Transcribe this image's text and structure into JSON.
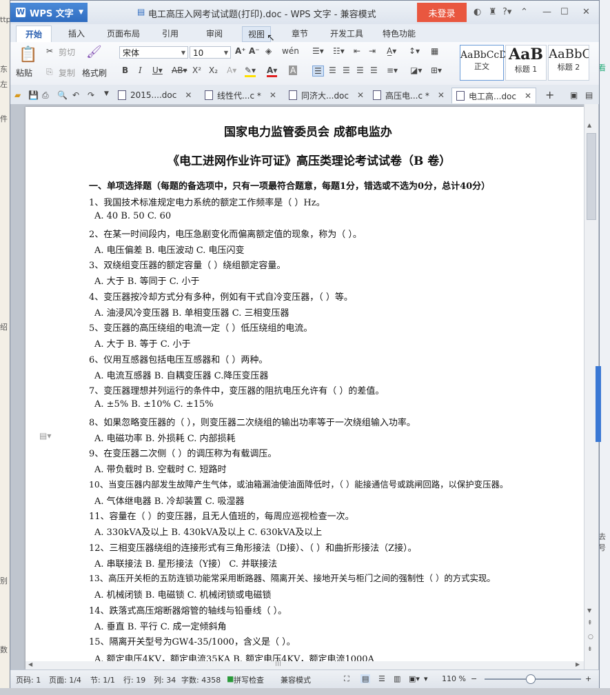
{
  "background": {
    "left_texts": [
      "ttp",
      "东",
      "左",
      "件",
      "绍",
      "别",
      "数"
    ],
    "right_texts": [
      "看",
      "去号"
    ]
  },
  "window": {
    "app_name": "WPS 文字",
    "title": "电工高压入网考试试题(打印).doc - WPS 文字 - 兼容模式",
    "login_label": "未登录"
  },
  "menu": {
    "tabs": [
      "开始",
      "插入",
      "页面布局",
      "引用",
      "审阅",
      "视图",
      "章节",
      "开发工具",
      "特色功能"
    ]
  },
  "ribbon": {
    "paste_label": "粘贴",
    "cut_label": "剪切",
    "copy_label": "复制",
    "format_painter_label": "格式刷",
    "font_name": "宋体",
    "font_size": "10",
    "styles": [
      {
        "preview": "AaBbCcD",
        "label": "正文"
      },
      {
        "preview": "AaB",
        "label": "标题 1"
      },
      {
        "preview": "AaBbC",
        "label": "标题 2"
      }
    ]
  },
  "doc_tabs": [
    {
      "label": "2015....doc",
      "modified": false
    },
    {
      "label": "线性代...c *",
      "modified": true
    },
    {
      "label": "同济大...doc",
      "modified": false
    },
    {
      "label": "高压电...c *",
      "modified": true
    },
    {
      "label": "电工高...doc",
      "modified": false,
      "active": true
    }
  ],
  "document": {
    "org_line": "国家电力监管委员会    成都电监办",
    "title": "《电工进网作业许可证》高压类理论考试试卷（B 卷）",
    "section": "一、单项选择题（每题的备选项中，只有一项最符合题意，每题1分，错选或不选为0分，总计40分）",
    "lines": [
      "1、我国技术标准规定电力系统的额定工作频率是（  ）Hz。",
      "  A. 40    B. 50   C. 60",
      "2、在某一时间段内，电压急剧变化而偏离额定值的现象，称为（  ）。",
      "  A. 电压偏差    B. 电压波动    C. 电压闪变",
      "3、双绕组变压器的额定容量（ ）绕组额定容量。",
      "  A. 大于       B. 等同于       C. 小于",
      "4、变压器按冷却方式分有多种，例如有干式自冷变压器，（  ）等。",
      "  A. 油浸风冷变压器         B. 单相变压器    C. 三相变压器",
      "5、变压器的高压绕组的电流一定（  ）低压绕组的电流。",
      "  A. 大于      B. 等于      C. 小于",
      "6、仪用互感器包括电压互感器和（  ）两种。",
      "  A. 电流互感器      B. 自耦变压器        C.降压变压器",
      "7、变压器理想并列运行的条件中，变压器的阻抗电压允许有（ ）的差值。",
      "  A. ±5%        B. ±10%        C. ±15%",
      "8、如果忽略变压器的（  ），则变压器二次绕组的输出功率等于一次绕组输入功率。",
      "  A. 电磁功率      B. 外损耗        C. 内部损耗",
      "9、在变压器二次侧（  ）的调压称为有载调压。",
      "  A. 带负载时        B. 空载时       C. 短路时",
      "10、当变压器内部发生故障产生气体，或油箱漏油使油面降低时，（ ）能接通信号或跳闸回路，以保护变压器。",
      "  A. 气体继电器        B. 冷却装置        C. 吸湿器",
      "11、容量在（ ）的变压器，且无人值班的，每周应巡视检查一次。",
      "  A. 330kVA及以上        B. 430kVA及以上          C. 630kVA及以上",
      "12、三相变压器绕组的连接形式有三角形接法（D接）、（  ）和曲折形接法（Z接）。",
      "  A. 串联接法        B. 星形接法（Y接）     C. 并联接法",
      "13、高压开关柜的五防连锁功能常采用断路器、隔离开关、接地开关与柜门之间的强制性（  ）的方式实现。",
      "  A. 机械闭锁     B. 电磁锁    C. 机械闭锁或电磁锁",
      "14、跌落式高压熔断器熔管的轴线与铅垂线（ ）。",
      "  A. 垂直    B. 平行    C. 成一定倾斜角",
      "15、隔离开关型号为GW4-35/1000，含义是（  ）。",
      "  A. 额定电压4KV，额定电流35KA     B. 额定电压4KV，额定电流1000A"
    ]
  },
  "status": {
    "page": "页码: 1",
    "pages": "页面: 1/4",
    "section": "节: 1/1",
    "row": "行: 19",
    "col": "列: 34",
    "words": "字数: 4358",
    "spell": "拼写检查",
    "mode": "兼容模式",
    "zoom": "110 %",
    "zoom_fraction": 0.47
  }
}
